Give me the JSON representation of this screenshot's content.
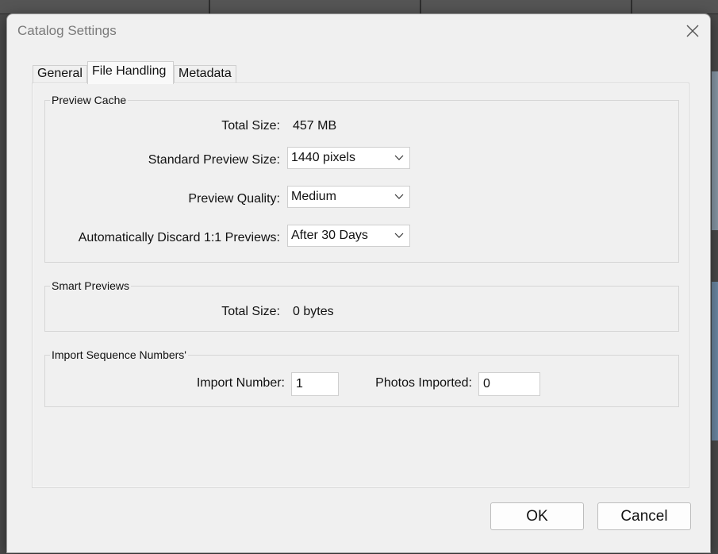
{
  "dialog": {
    "title": "Catalog Settings",
    "close_icon": "close-icon"
  },
  "tabs": [
    {
      "label": "General",
      "active": false
    },
    {
      "label": "File Handling",
      "active": true
    },
    {
      "label": "Metadata",
      "active": false
    }
  ],
  "preview_cache": {
    "legend": "Preview Cache",
    "total_size_label": "Total Size:",
    "total_size_value": "457 MB",
    "standard_preview_size_label": "Standard Preview Size:",
    "standard_preview_size_value": "1440 pixels",
    "preview_quality_label": "Preview Quality:",
    "preview_quality_value": "Medium",
    "discard_label": "Automatically Discard 1:1 Previews:",
    "discard_value": "After 30 Days"
  },
  "smart_previews": {
    "legend": "Smart Previews",
    "total_size_label": "Total Size:",
    "total_size_value": "0 bytes"
  },
  "import_sequence": {
    "legend": "Import Sequence Numbers'",
    "import_number_label": "Import Number:",
    "import_number_value": "1",
    "photos_imported_label": "Photos Imported:",
    "photos_imported_value": "0"
  },
  "buttons": {
    "ok": "OK",
    "cancel": "Cancel"
  },
  "colors": {
    "dialog_bg": "#f0f0f0",
    "title_text": "#7a7a7a"
  }
}
